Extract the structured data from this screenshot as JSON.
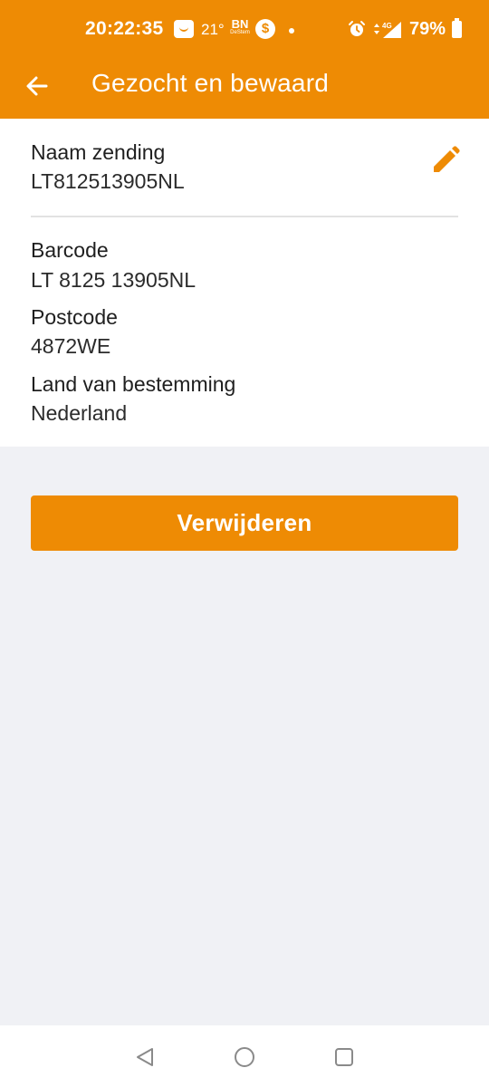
{
  "status_bar": {
    "time": "20:22:35",
    "temperature": "21°",
    "news_app_line1": "BN",
    "news_app_line2": "DeStem",
    "payment_icon_glyph": "$",
    "network": "4G",
    "battery": "79%",
    "icons": [
      "face-icon",
      "bn-destem-icon",
      "dollar-icon",
      "dot-icon",
      "alarm-icon",
      "network-icon",
      "battery-icon"
    ]
  },
  "app_bar": {
    "title": "Gezocht en bewaard",
    "back_icon": "arrow-left-icon"
  },
  "shipment": {
    "name_label": "Naam zending",
    "name_value": "LT812513905NL",
    "edit_icon": "pencil-icon",
    "barcode_label": "Barcode",
    "barcode_value": "LT 8125 13905NL",
    "postcode_label": "Postcode",
    "postcode_value": "4872WE",
    "country_label": "Land van bestemming",
    "country_value": "Nederland"
  },
  "actions": {
    "delete_label": "Verwijderen"
  },
  "nav_bar": {
    "icons": [
      "back-triangle-icon",
      "home-circle-icon",
      "recents-square-icon"
    ]
  },
  "colors": {
    "accent": "#ee8b04",
    "background": "#f0f1f5",
    "card": "#ffffff",
    "text": "#1f1f1f"
  }
}
